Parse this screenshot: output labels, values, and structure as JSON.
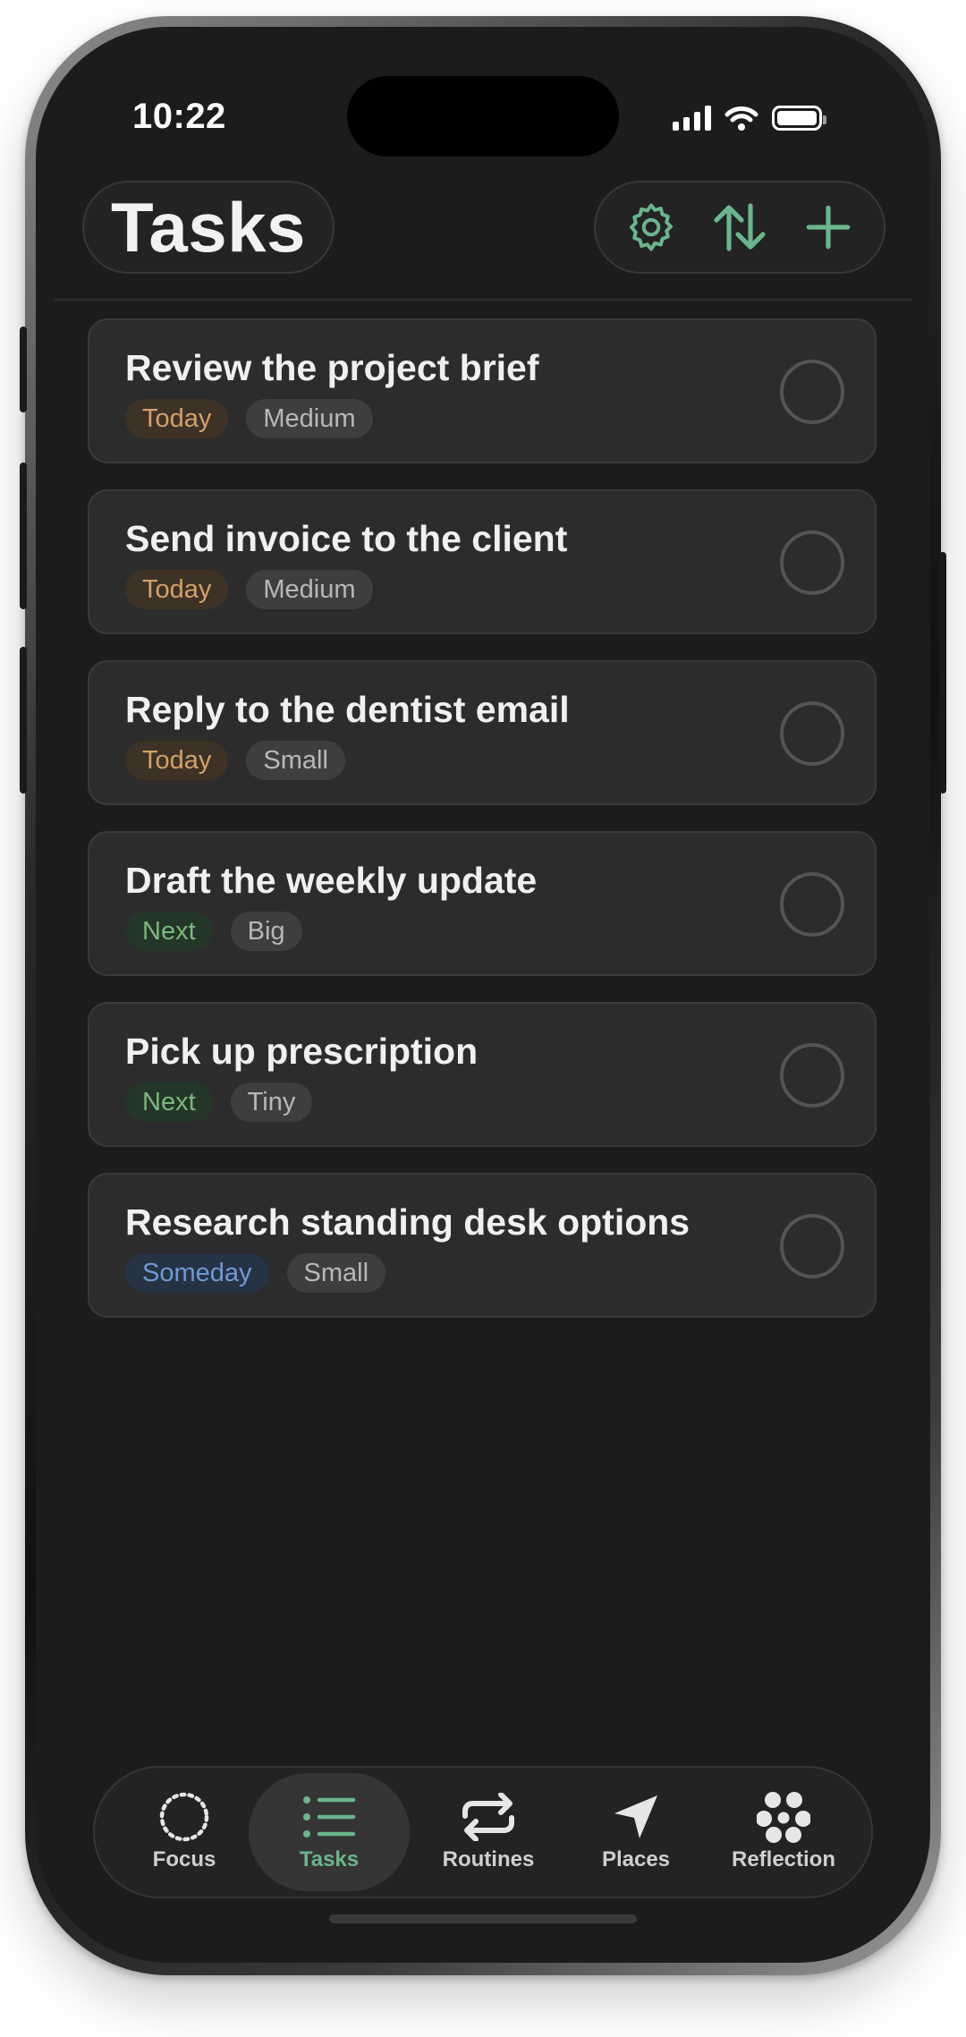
{
  "status_bar": {
    "time": "10:22"
  },
  "header": {
    "title": "Tasks"
  },
  "actions": [
    {
      "name": "settings-button",
      "icon": "gear-icon"
    },
    {
      "name": "sort-button",
      "icon": "sort-arrows-icon"
    },
    {
      "name": "add-task-button",
      "icon": "plus-icon"
    }
  ],
  "tasks": [
    {
      "title": "Review the project brief",
      "when": "Today",
      "size": "Medium"
    },
    {
      "title": "Send invoice to the client",
      "when": "Today",
      "size": "Medium"
    },
    {
      "title": "Reply to the dentist email",
      "when": "Today",
      "size": "Small"
    },
    {
      "title": "Draft the weekly update",
      "when": "Next",
      "size": "Big"
    },
    {
      "title": "Pick up prescription",
      "when": "Next",
      "size": "Tiny"
    },
    {
      "title": "Research standing desk options",
      "when": "Someday",
      "size": "Small"
    }
  ],
  "tabs": [
    {
      "label": "Focus",
      "icon": "dotted-circle-icon"
    },
    {
      "label": "Tasks",
      "icon": "list-icon",
      "active": true
    },
    {
      "label": "Routines",
      "icon": "repeat-icon"
    },
    {
      "label": "Places",
      "icon": "location-arrow-icon"
    },
    {
      "label": "Reflection",
      "icon": "flower-icon"
    }
  ],
  "colors": {
    "background": "#1c1c1c",
    "card": "#2c2c2c",
    "accent": "#6ab58c",
    "today": "#d4a06a",
    "next": "#7bb87e",
    "someday": "#6f9ad4"
  }
}
